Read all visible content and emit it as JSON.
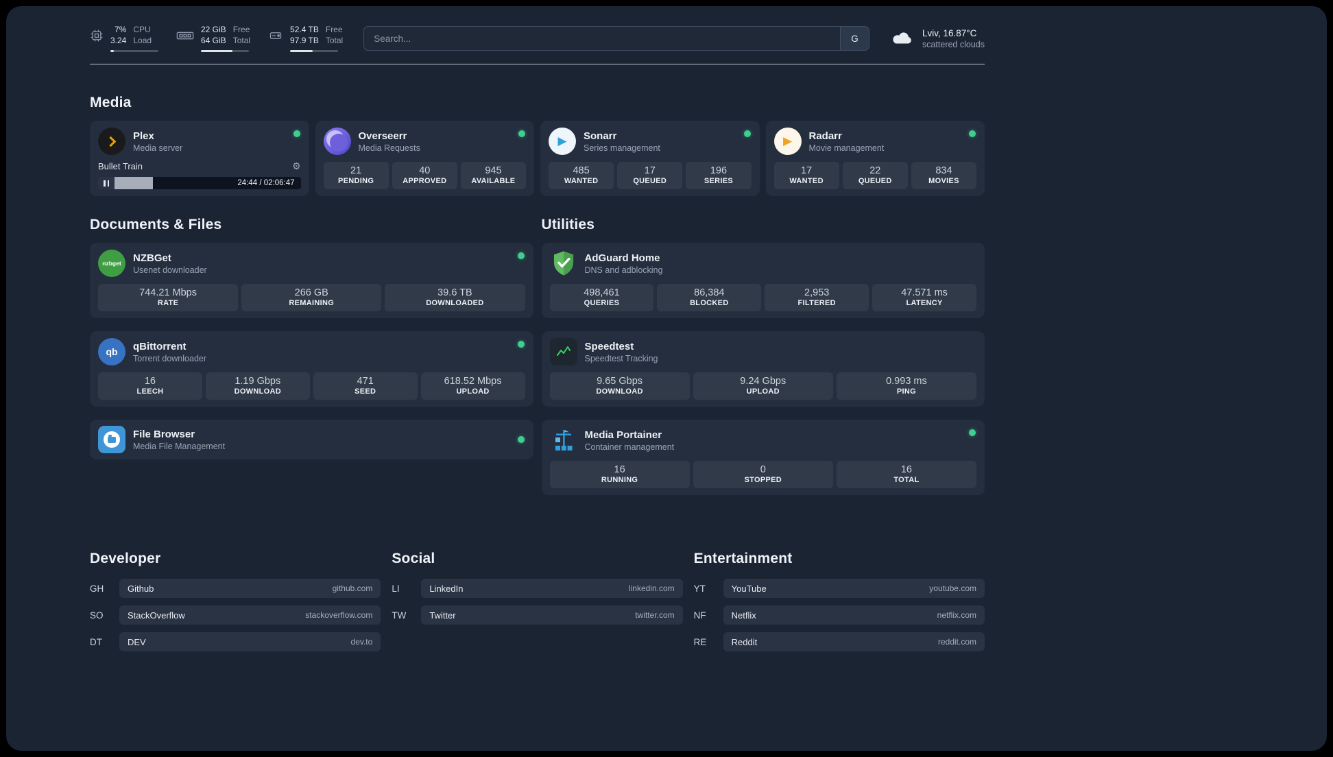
{
  "topbar": {
    "cpu": {
      "value_top": "7%",
      "value_bottom": "3.24",
      "label_top": "CPU",
      "label_bottom": "Load"
    },
    "ram": {
      "value_top": "22 GiB",
      "value_bottom": "64 GiB",
      "label_top": "Free",
      "label_bottom": "Total"
    },
    "disk": {
      "value_top": "52.4 TB",
      "value_bottom": "97.9 TB",
      "label_top": "Free",
      "label_bottom": "Total"
    },
    "search": {
      "placeholder": "Search...",
      "engine_button": "G"
    },
    "weather": {
      "location": "Lviv, 16.87°C",
      "condition": "scattered clouds"
    }
  },
  "sections": {
    "media": {
      "title": "Media",
      "plex": {
        "name": "Plex",
        "subtitle": "Media server",
        "now_playing": "Bullet Train",
        "time": "24:44 / 02:06:47"
      },
      "overseerr": {
        "name": "Overseerr",
        "subtitle": "Media Requests",
        "stats": [
          {
            "value": "21",
            "label": "PENDING"
          },
          {
            "value": "40",
            "label": "APPROVED"
          },
          {
            "value": "945",
            "label": "AVAILABLE"
          }
        ]
      },
      "sonarr": {
        "name": "Sonarr",
        "subtitle": "Series management",
        "stats": [
          {
            "value": "485",
            "label": "WANTED"
          },
          {
            "value": "17",
            "label": "QUEUED"
          },
          {
            "value": "196",
            "label": "SERIES"
          }
        ]
      },
      "radarr": {
        "name": "Radarr",
        "subtitle": "Movie management",
        "stats": [
          {
            "value": "17",
            "label": "WANTED"
          },
          {
            "value": "22",
            "label": "QUEUED"
          },
          {
            "value": "834",
            "label": "MOVIES"
          }
        ]
      }
    },
    "documents": {
      "title": "Documents & Files",
      "nzbget": {
        "name": "NZBGet",
        "subtitle": "Usenet downloader",
        "icon_text": "nzbget",
        "stats": [
          {
            "value": "744.21 Mbps",
            "label": "RATE"
          },
          {
            "value": "266 GB",
            "label": "REMAINING"
          },
          {
            "value": "39.6 TB",
            "label": "DOWNLOADED"
          }
        ]
      },
      "qbittorrent": {
        "name": "qBittorrent",
        "subtitle": "Torrent downloader",
        "icon_text": "qb",
        "stats": [
          {
            "value": "16",
            "label": "LEECH"
          },
          {
            "value": "1.19 Gbps",
            "label": "DOWNLOAD"
          },
          {
            "value": "471",
            "label": "SEED"
          },
          {
            "value": "618.52 Mbps",
            "label": "UPLOAD"
          }
        ]
      },
      "filebrowser": {
        "name": "File Browser",
        "subtitle": "Media File Management"
      }
    },
    "utilities": {
      "title": "Utilities",
      "adguard": {
        "name": "AdGuard Home",
        "subtitle": "DNS and adblocking",
        "stats": [
          {
            "value": "498,461",
            "label": "QUERIES"
          },
          {
            "value": "86,384",
            "label": "BLOCKED"
          },
          {
            "value": "2,953",
            "label": "FILTERED"
          },
          {
            "value": "47.571 ms",
            "label": "LATENCY"
          }
        ]
      },
      "speedtest": {
        "name": "Speedtest",
        "subtitle": "Speedtest Tracking",
        "stats": [
          {
            "value": "9.65 Gbps",
            "label": "DOWNLOAD"
          },
          {
            "value": "9.24 Gbps",
            "label": "UPLOAD"
          },
          {
            "value": "0.993 ms",
            "label": "PING"
          }
        ]
      },
      "portainer": {
        "name": "Media Portainer",
        "subtitle": "Container management",
        "stats": [
          {
            "value": "16",
            "label": "RUNNING"
          },
          {
            "value": "0",
            "label": "STOPPED"
          },
          {
            "value": "16",
            "label": "TOTAL"
          }
        ]
      }
    }
  },
  "bookmarks": {
    "developer": {
      "title": "Developer",
      "items": [
        {
          "abbr": "GH",
          "name": "Github",
          "url": "github.com"
        },
        {
          "abbr": "SO",
          "name": "StackOverflow",
          "url": "stackoverflow.com"
        },
        {
          "abbr": "DT",
          "name": "DEV",
          "url": "dev.to"
        }
      ]
    },
    "social": {
      "title": "Social",
      "items": [
        {
          "abbr": "LI",
          "name": "LinkedIn",
          "url": "linkedin.com"
        },
        {
          "abbr": "TW",
          "name": "Twitter",
          "url": "twitter.com"
        }
      ]
    },
    "entertainment": {
      "title": "Entertainment",
      "items": [
        {
          "abbr": "YT",
          "name": "YouTube",
          "url": "youtube.com"
        },
        {
          "abbr": "NF",
          "name": "Netflix",
          "url": "netflix.com"
        },
        {
          "abbr": "RE",
          "name": "Reddit",
          "url": "reddit.com"
        }
      ]
    }
  },
  "icons": {
    "gear": "⚙",
    "play": "▶"
  },
  "colors": {
    "status_online": "#3ecf8e",
    "plex_amber": "#e5a00d",
    "overseerr_purple": "#6e60da",
    "sonarr_blue": "#2ea3db",
    "radarr_amber": "#eda426",
    "nzbget_green": "#3f9e43",
    "qbittorrent_blue": "#3873c3",
    "filebrowser_blue": "#3f96d6",
    "adguard_green": "#5fba61",
    "speedtest_green": "#37d05c",
    "portainer_blue": "#2f9fe0"
  }
}
